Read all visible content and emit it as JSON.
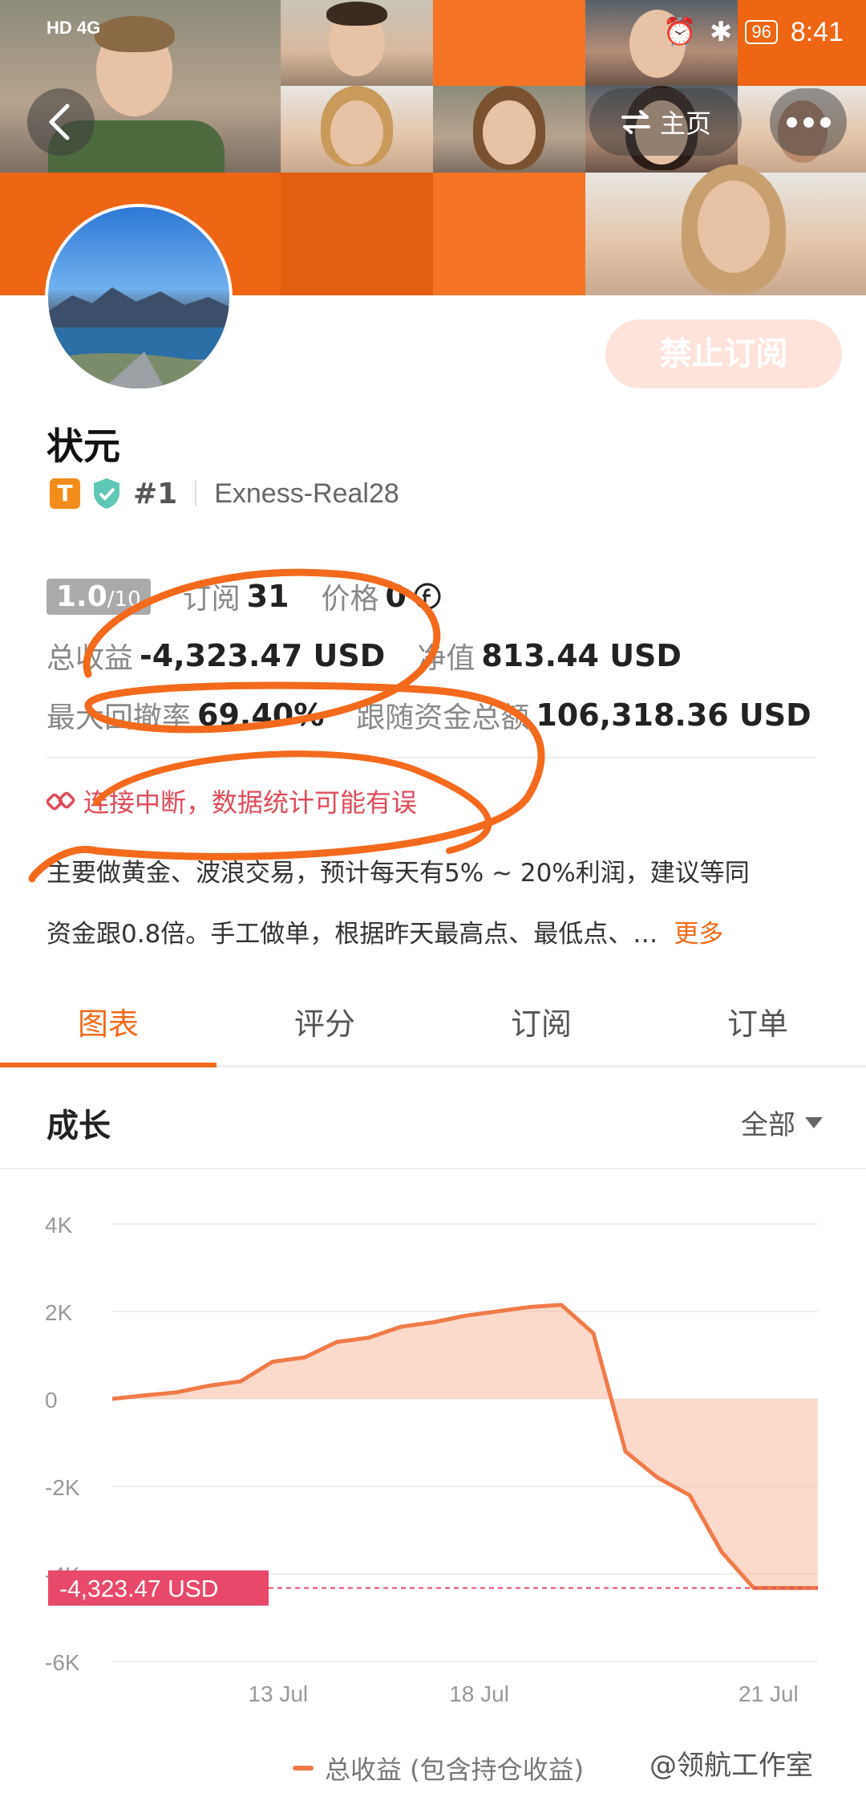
{
  "status_bar": {
    "left": "HD 4G",
    "battery": "96",
    "time": "8:41"
  },
  "nav": {
    "home_label": "主页"
  },
  "profile": {
    "subscribe_button": "禁止订阅",
    "name": "状元",
    "tag_letter": "T",
    "rank": "#1",
    "account": "Exness-Real28"
  },
  "stats": {
    "score_main": "1.0",
    "score_sub": "/10",
    "subscribe_label": "订阅",
    "subscribe_value": "31",
    "price_label": "价格",
    "price_value": "0",
    "total_profit_label": "总收益",
    "total_profit_value": "-4,323.47 USD",
    "equity_label": "净值",
    "equity_value": "813.44 USD",
    "max_drawdown_label": "最大回撤率",
    "max_drawdown_value": "69.40%",
    "follow_funds_label": "跟随资金总额",
    "follow_funds_value": "106,318.36 USD"
  },
  "warning": "连接中断，数据统计可能有误",
  "description": {
    "line1": "主要做黄金、波浪交易，预计每天有5% ~ 20%利润，建议等同",
    "line2": "资金跟0.8倍。手工做单，根据昨天最高点、最低点、…",
    "more": "更多"
  },
  "tabs": [
    {
      "label": "图表",
      "active": true
    },
    {
      "label": "评分",
      "active": false
    },
    {
      "label": "订阅",
      "active": false
    },
    {
      "label": "订单",
      "active": false
    }
  ],
  "section": {
    "title": "成长",
    "filter": "全部"
  },
  "chart_data": {
    "type": "area",
    "y_ticks": [
      "4K",
      "2K",
      "0",
      "-2K",
      "-4K",
      "-6K"
    ],
    "ylim": [
      -6000,
      4000
    ],
    "x_ticks": [
      "13 Jul",
      "18 Jul",
      "21 Jul"
    ],
    "x": [
      0,
      1,
      2,
      3,
      4,
      5,
      6,
      7,
      8,
      9,
      10,
      11,
      12,
      13,
      14,
      15,
      16,
      17,
      18,
      19,
      20,
      21,
      22
    ],
    "values": [
      0,
      80,
      150,
      300,
      400,
      850,
      950,
      1300,
      1400,
      1650,
      1750,
      1900,
      2000,
      2100,
      2150,
      1500,
      -1200,
      -1800,
      -2200,
      -3500,
      -4323.47,
      -4323.47,
      -4323.47
    ],
    "current_label": "-4,323.47 USD",
    "legend": "总收益 (包含持仓收益)",
    "colors": {
      "line": "#f07a48",
      "fill": "#f9c1a8",
      "label_bg": "#e8496a"
    }
  },
  "watermark": "@领航工作室"
}
